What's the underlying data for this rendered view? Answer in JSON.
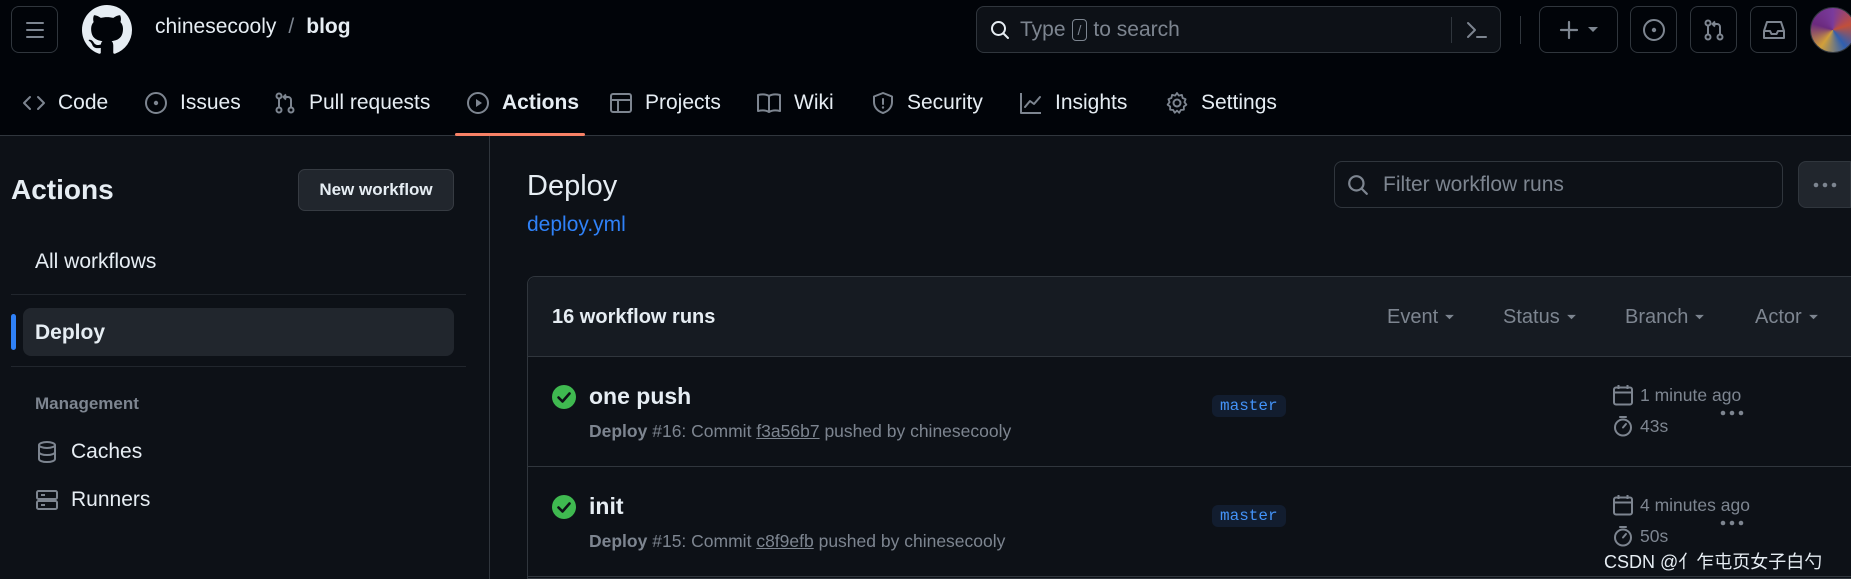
{
  "header": {
    "owner": "chinesecooly",
    "separator": "/",
    "repo": "blog",
    "search": {
      "prefix": "Type",
      "key": "/",
      "suffix": "to search"
    }
  },
  "tabs": [
    {
      "label": "Code",
      "icon": "code-icon"
    },
    {
      "label": "Issues",
      "icon": "issue-opened-icon"
    },
    {
      "label": "Pull requests",
      "icon": "git-pull-request-icon"
    },
    {
      "label": "Actions",
      "icon": "play-icon",
      "active": true
    },
    {
      "label": "Projects",
      "icon": "table-icon"
    },
    {
      "label": "Wiki",
      "icon": "book-icon"
    },
    {
      "label": "Security",
      "icon": "shield-icon"
    },
    {
      "label": "Insights",
      "icon": "graph-icon"
    },
    {
      "label": "Settings",
      "icon": "gear-icon"
    }
  ],
  "sidebar": {
    "title": "Actions",
    "new_workflow": "New workflow",
    "all_workflows": "All workflows",
    "selected": "Deploy",
    "management_title": "Management",
    "caches": "Caches",
    "runners": "Runners"
  },
  "main": {
    "title": "Deploy",
    "file_link": "deploy.yml",
    "filter_placeholder": "Filter workflow runs",
    "runs_count": "16 workflow runs",
    "filters": [
      "Event",
      "Status",
      "Branch",
      "Actor"
    ],
    "runs": [
      {
        "title": "one push",
        "workflow": "Deploy",
        "rest": "#16: Commit",
        "commit": "f3a56b7",
        "by": "pushed by chinesecooly",
        "branch": "master",
        "time": "1 minute ago",
        "duration": "43s",
        "status": "success"
      },
      {
        "title": "init",
        "workflow": "Deploy",
        "rest": "#15: Commit",
        "commit": "c8f9efb",
        "by": "pushed by chinesecooly",
        "branch": "master",
        "time": "4 minutes ago",
        "duration": "50s",
        "status": "success"
      }
    ]
  },
  "watermark": "CSDN @亻乍屯页女子白勺",
  "colors": {
    "accent": "#2f81f7",
    "success": "#3fb950",
    "underline": "#f78166",
    "bg": "#0d1117"
  }
}
